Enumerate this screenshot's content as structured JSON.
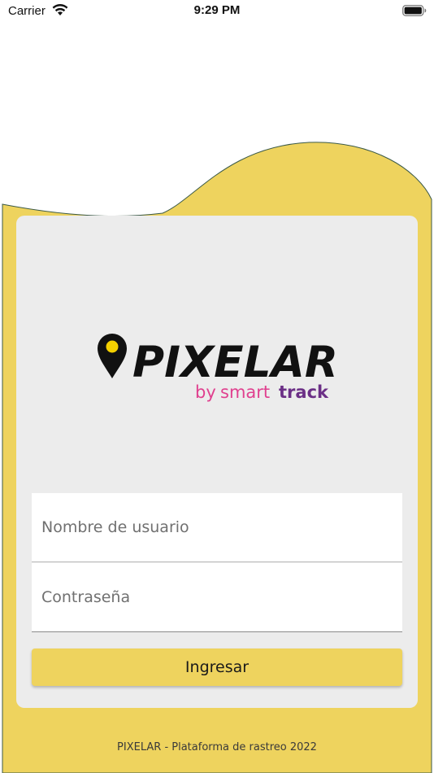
{
  "status_bar": {
    "carrier": "Carrier",
    "time": "9:29 PM",
    "wifi_icon": "wifi-icon",
    "battery_icon": "battery-icon"
  },
  "colors": {
    "accent_yellow": "#eed35e",
    "card_bg": "#ececec",
    "brand_pink": "#e0408f",
    "brand_purple": "#6b2f86"
  },
  "logo": {
    "name": "PIXELAR",
    "by": "by",
    "smart": "smart",
    "track": "track"
  },
  "form": {
    "username_placeholder": "Nombre de usuario",
    "password_placeholder": "Contraseña",
    "submit_label": "Ingresar"
  },
  "footer": {
    "text": "PIXELAR - Plataforma de rastreo 2022"
  }
}
